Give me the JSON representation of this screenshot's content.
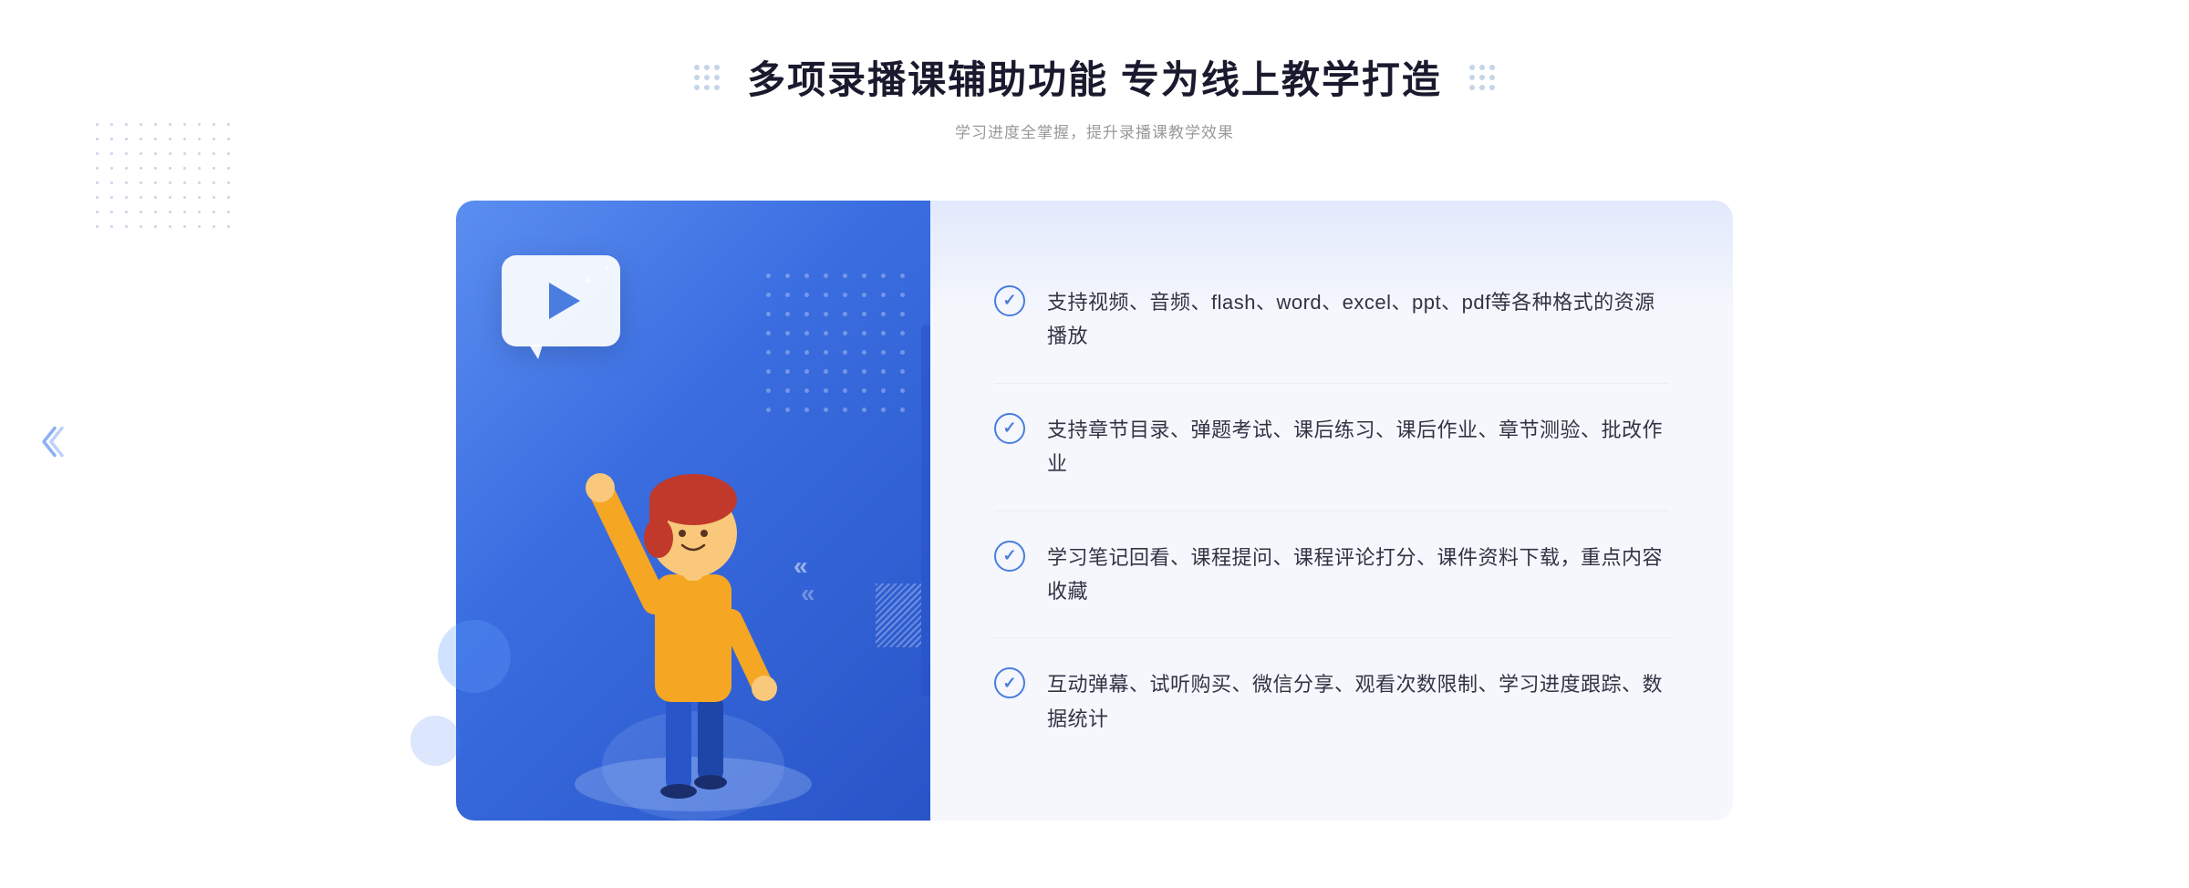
{
  "page": {
    "title": "多项录播课辅助功能 专为线上教学打造",
    "subtitle": "学习进度全掌握，提升录播课教学效果",
    "features": [
      {
        "id": "feature-1",
        "text": "支持视频、音频、flash、word、excel、ppt、pdf等各种格式的资源播放"
      },
      {
        "id": "feature-2",
        "text": "支持章节目录、弹题考试、课后练习、课后作业、章节测验、批改作业"
      },
      {
        "id": "feature-3",
        "text": "学习笔记回看、课程提问、课程评论打分、课件资料下载，重点内容收藏"
      },
      {
        "id": "feature-4",
        "text": "互动弹幕、试听购买、微信分享、观看次数限制、学习进度跟踪、数据统计"
      }
    ],
    "left_panel": {
      "play_label": "播放",
      "figure_alt": "教师指向黑板插图"
    },
    "decorations": {
      "title_dot_rows": 3,
      "title_dot_cols": 3
    },
    "colors": {
      "primary_blue": "#4a7de0",
      "panel_gradient_start": "#5b8ef0",
      "panel_gradient_end": "#2855c8",
      "text_dark": "#1a1a2e",
      "text_gray": "#999999",
      "feature_text": "#333344",
      "bg_light": "#f5f7fd",
      "border_light": "#e8edf8"
    }
  }
}
